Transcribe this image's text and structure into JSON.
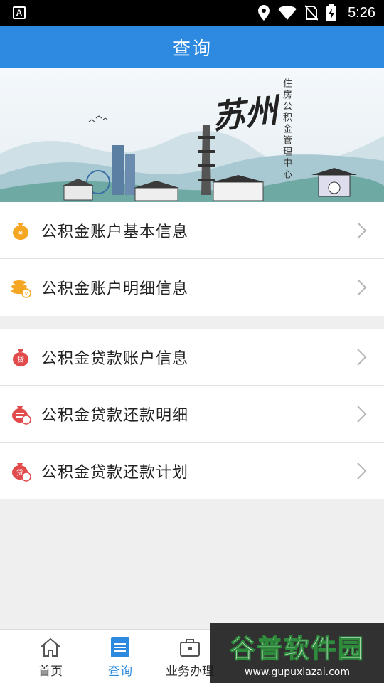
{
  "status_bar": {
    "left_icon": "A",
    "time": "5:26",
    "icons": [
      "location-icon",
      "wifi-icon",
      "no-sim-icon",
      "battery-charging-icon"
    ]
  },
  "app_bar": {
    "title": "查询"
  },
  "banner": {
    "city_text": "苏州",
    "org_text": "住房公积金管理中心"
  },
  "groups": [
    {
      "items": [
        {
          "label": "公积金账户基本信息",
          "icon": "coin-bag-icon"
        },
        {
          "label": "公积金账户明细信息",
          "icon": "coin-stack-icon"
        }
      ]
    },
    {
      "items": [
        {
          "label": "公积金贷款账户信息",
          "icon": "loan-bag-icon"
        },
        {
          "label": "公积金贷款还款明细",
          "icon": "loan-detail-icon"
        },
        {
          "label": "公积金贷款还款计划",
          "icon": "loan-plan-icon"
        }
      ]
    }
  ],
  "tab_bar": {
    "tabs": [
      {
        "label": "首页",
        "icon": "home-icon",
        "active": false
      },
      {
        "label": "查询",
        "icon": "list-icon",
        "active": true
      },
      {
        "label": "业务办理",
        "icon": "briefcase-icon",
        "active": false
      }
    ]
  },
  "watermark": {
    "title": "谷普软件园",
    "url": "www.gupuxlazai.com"
  },
  "colors": {
    "primary": "#2d8ae0",
    "coin_orange": "#f5a623",
    "loan_red": "#e24b4b"
  }
}
